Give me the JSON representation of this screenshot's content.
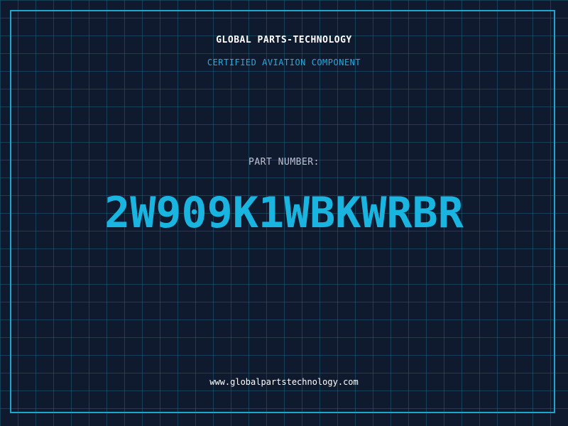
{
  "header": {
    "company": "GLOBAL PARTS-TECHNOLOGY",
    "subtitle": "CERTIFIED AVIATION COMPONENT"
  },
  "part": {
    "label": "PART NUMBER:",
    "number": "2W909K1WBKWRBR"
  },
  "footer": {
    "website": "www.globalpartstechnology.com"
  },
  "colors": {
    "background": "#101a2e",
    "grid": "#1e6e8c",
    "accent": "#19b4e0",
    "frame": "#1aa6cf"
  }
}
